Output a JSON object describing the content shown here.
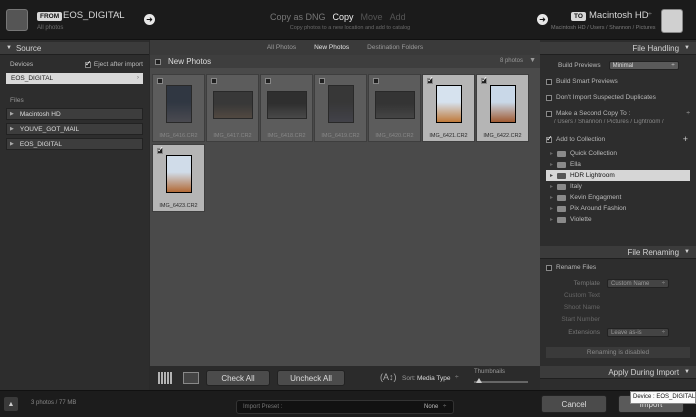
{
  "source": {
    "from_badge": "FROM",
    "name": "EOS_DIGITAL",
    "subtitle": "All photos",
    "header": "Source",
    "devices_label": "Devices",
    "eject_label": "Eject after import",
    "device_selected": "EOS_DIGITAL",
    "files_label": "Files",
    "files": [
      "Macintosh HD",
      "YOUVE_GOT_MAIL",
      "EOS_DIGITAL"
    ]
  },
  "modes": {
    "copy_as_dng": "Copy as DNG",
    "copy": "Copy",
    "move": "Move",
    "add": "Add",
    "description": "Copy photos to a new location and add to catalog"
  },
  "destination": {
    "to_badge": "TO",
    "name": "Macintosh HD",
    "path": "Macintosh HD / Users / Shannon / Pictures"
  },
  "view_tabs": [
    "All Photos",
    "New Photos",
    "Destination Folders"
  ],
  "grid": {
    "title": "New Photos",
    "count": "8 photos",
    "photos": [
      {
        "name": "IMG_6416.CR2",
        "checked": false,
        "selected": false
      },
      {
        "name": "IMG_6417.CR2",
        "checked": false,
        "selected": false
      },
      {
        "name": "IMG_6418.CR2",
        "checked": false,
        "selected": false
      },
      {
        "name": "IMG_6419.CR2",
        "checked": false,
        "selected": false
      },
      {
        "name": "IMG_6420.CR2",
        "checked": false,
        "selected": false
      },
      {
        "name": "IMG_6421.CR2",
        "checked": true,
        "selected": true
      },
      {
        "name": "IMG_6422.CR2",
        "checked": true,
        "selected": true
      },
      {
        "name": "IMG_6423.CR2",
        "checked": true,
        "selected": true
      }
    ]
  },
  "toolbar": {
    "check_all": "Check All",
    "uncheck_all": "Uncheck All",
    "sort_label": "Sort:",
    "sort_value": "Media Type",
    "thumbnails_label": "Thumbnails"
  },
  "file_handling": {
    "header": "File Handling",
    "build_previews_label": "Build Previews",
    "build_previews_value": "Minimal",
    "build_smart_previews": "Build Smart Previews",
    "dont_import_dupes": "Don't Import Suspected Duplicates",
    "second_copy": "Make a Second Copy To :",
    "second_copy_path": "/ Users / Shannon / Pictures / Lightroom /",
    "add_to_collection": "Add to Collection",
    "collections": [
      "Quick Collection",
      "Ella",
      "HDR Lightroom",
      "Italy",
      "Kevin Engagment",
      "Pix Around Fashion",
      "Violette"
    ],
    "selected_collection": "HDR Lightroom"
  },
  "file_renaming": {
    "header": "File Renaming",
    "rename_files": "Rename Files",
    "template_label": "Template",
    "template_value": "Custom Name",
    "custom_text": "Custom Text",
    "shoot_name": "Shoot Name",
    "start_number": "Start Number",
    "extensions_label": "Extensions",
    "extensions_value": "Leave as-is",
    "disabled_note": "Renaming is disabled"
  },
  "apply_during_import": {
    "header": "Apply During Import"
  },
  "footer": {
    "summary": "3 photos / 77 MB",
    "import_preset_label": "Import Preset :",
    "import_preset_value": "None",
    "cancel": "Cancel",
    "import": "Import",
    "tooltip": "Device : EOS_DIGITAL"
  }
}
